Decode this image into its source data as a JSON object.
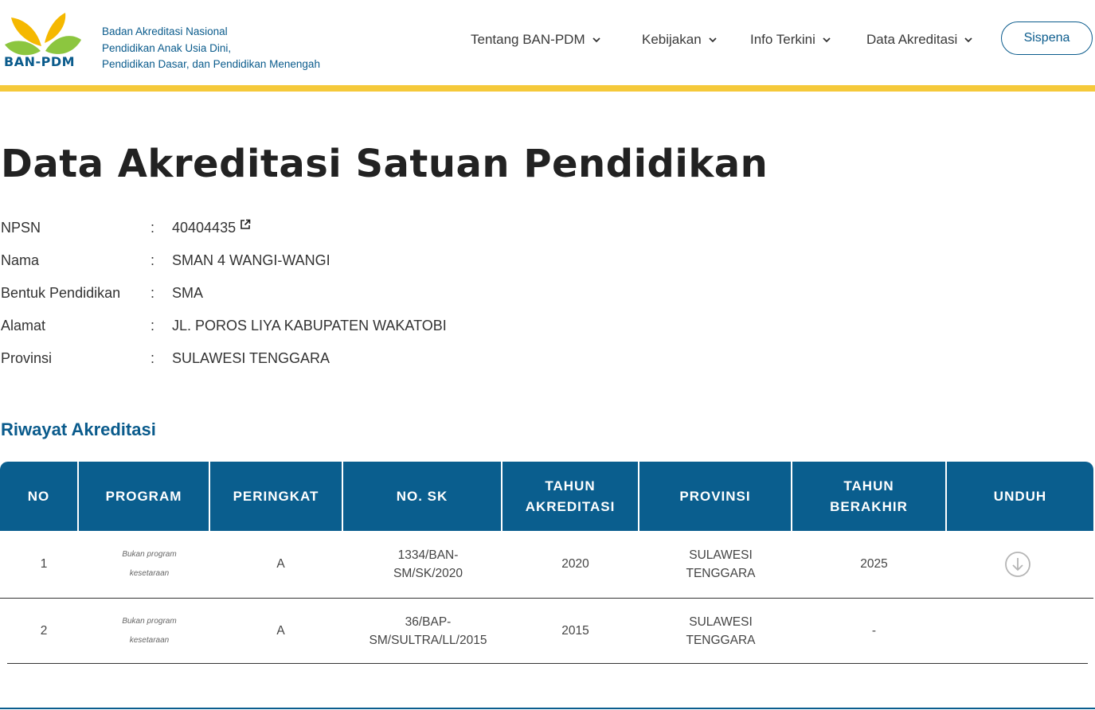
{
  "header": {
    "logo_text": "BAN-PDM",
    "org_lines": [
      "Badan Akreditasi Nasional",
      "Pendidikan Anak Usia Dini,",
      "Pendidikan Dasar, dan Pendidikan Menengah"
    ],
    "nav": [
      {
        "label": "Tentang BAN-PDM"
      },
      {
        "label": "Kebijakan"
      },
      {
        "label": "Info Terkini"
      },
      {
        "label": "Data Akreditasi"
      }
    ],
    "sispena_label": "Sispena"
  },
  "colors": {
    "brand_blue": "#0a5e8e",
    "accent_yellow": "#f5c93a",
    "leaf_green": "#8cc63f",
    "leaf_yellow": "#f5b800"
  },
  "page": {
    "title": "Data Akreditasi Satuan Pendidikan",
    "info": [
      {
        "label": "NPSN",
        "value": "40404435",
        "icon": "external-link-icon"
      },
      {
        "label": "Nama",
        "value": "SMAN 4 WANGI-WANGI"
      },
      {
        "label": "Bentuk Pendidikan",
        "value": "SMA"
      },
      {
        "label": "Alamat",
        "value": "JL. POROS LIYA KABUPATEN WAKATOBI"
      },
      {
        "label": "Provinsi",
        "value": "SULAWESI TENGGARA"
      }
    ],
    "colon": ":",
    "section_title": "Riwayat Akreditasi"
  },
  "table": {
    "headers": [
      "NO",
      "PROGRAM",
      "PERINGKAT",
      "NO. SK",
      "TAHUN AKREDITASI",
      "PROVINSI",
      "TAHUN BERAKHIR",
      "UNDUH"
    ],
    "rows": [
      {
        "no": "1",
        "program": "Bukan program kesetaraan",
        "peringkat": "A",
        "no_sk": "1334/BAN-SM/SK/2020",
        "tahun_akreditasi": "2020",
        "provinsi": "SULAWESI TENGGARA",
        "tahun_berakhir": "2025",
        "unduh_icon": "download-icon"
      },
      {
        "no": "2",
        "program": "Bukan program kesetaraan",
        "peringkat": "A",
        "no_sk": "36/BAP-SM/SULTRA/LL/2015",
        "tahun_akreditasi": "2015",
        "provinsi": "SULAWESI TENGGARA",
        "tahun_berakhir": "-",
        "unduh_icon": ""
      }
    ]
  }
}
